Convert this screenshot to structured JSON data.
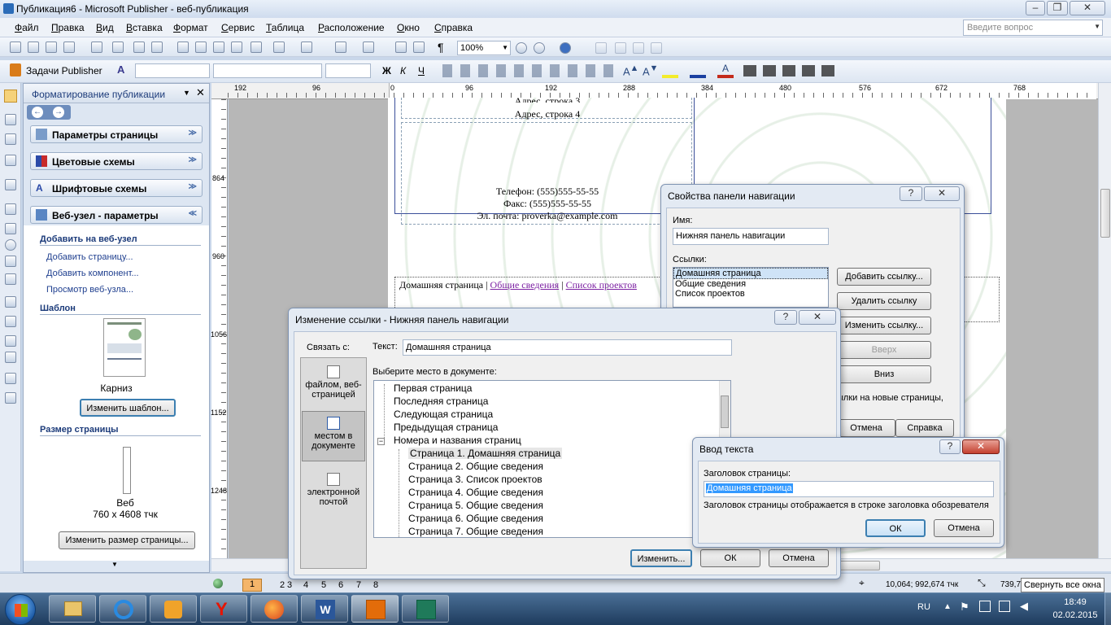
{
  "window": {
    "title": "Публикация6 - Microsoft Publisher - веб-публикация"
  },
  "menu": [
    "Файл",
    "Правка",
    "Вид",
    "Вставка",
    "Формат",
    "Сервис",
    "Таблица",
    "Расположение",
    "Окно",
    "Справка"
  ],
  "ask": {
    "placeholder": "Введите вопрос"
  },
  "toolbar": {
    "zoom": "100%",
    "tasks": "Задачи Publisher"
  },
  "ruler_h": [
    "192",
    "96",
    "0",
    "96",
    "192",
    "288",
    "384",
    "480",
    "576",
    "672",
    "768"
  ],
  "ruler_v": [
    "864",
    "960",
    "1056",
    "1152",
    "1248"
  ],
  "taskpane": {
    "title": "Форматирование публикации",
    "sections": [
      "Параметры страницы",
      "Цветовые схемы",
      "Шрифтовые схемы",
      "Веб-узел - параметры"
    ],
    "add_header": "Добавить на веб-узел",
    "links": [
      "Добавить страницу...",
      "Добавить компонент...",
      "Просмотр веб-узла..."
    ],
    "template_header": "Шаблон",
    "template_name": "Карниз",
    "change_template": "Изменить шаблон...",
    "size_header": "Размер страницы",
    "size_name": "Веб",
    "size_value": "760 x 4608 тчк",
    "change_size": "Изменить размер страницы..."
  },
  "page": {
    "address": "Адрес, строка 4",
    "address_prev": "Адрес, строка 3",
    "phone": "Телефон: (555)555-55-55",
    "fax": "Факс: (555)555-55-55",
    "email": "Эл. почта: proverka@example.com",
    "nav": [
      "Домашняя страница",
      "Общие сведения",
      "Список проектов"
    ]
  },
  "nav_dialog": {
    "title": "Свойства панели навигации",
    "name_label": "Имя:",
    "name_value": "Нижняя панель навигации",
    "links_label": "Ссылки:",
    "links": [
      "Домашняя страница",
      "Общие сведения",
      "Список проектов"
    ],
    "btn_add": "Добавить ссылку...",
    "btn_remove": "Удалить ссылку",
    "btn_change": "Изменить ссылку...",
    "btn_up": "Вверх",
    "btn_down": "Вниз",
    "checkbox_text": "ылки на новые страницы,",
    "btn_cancel": "Отмена",
    "btn_help": "Справка"
  },
  "link_dialog": {
    "title": "Изменение ссылки - Нижняя панель навигации",
    "link_to": "Связать с:",
    "opt_file": "файлом, веб-страницей",
    "opt_place": "местом в документе",
    "opt_email": "электронной почтой",
    "text_label": "Текст:",
    "text_value": "Домашняя страница",
    "choose_label": "Выберите место в документе:",
    "tree": [
      "Первая страница",
      "Последняя страница",
      "Следующая страница",
      "Предыдущая страница",
      "Номера и названия страниц",
      "Страница 1. Домашняя страница",
      "Страница 2. Общие сведения",
      "Страница 3. Список проектов",
      "Страница 4. Общие сведения",
      "Страница 5. Общие сведения",
      "Страница 6. Общие сведения",
      "Страница 7. Общие сведения"
    ],
    "btn_change": "Изменить...",
    "btn_ok": "ОК",
    "btn_cancel": "Отмена"
  },
  "input_dialog": {
    "title": "Ввод текста",
    "label": "Заголовок страницы:",
    "value": "Домашняя страница",
    "hint": "Заголовок страницы отображается в строке заголовка обозревателя",
    "btn_ok": "ОК",
    "btn_cancel": "Отмена"
  },
  "statusbar": {
    "pages": [
      "1",
      "2",
      "3",
      "4",
      "5",
      "6",
      "7",
      "8"
    ],
    "coords": "10,064; 992,674 тчк",
    "size": "739,7",
    "tooltip": "Свернуть все окна"
  },
  "taskbar": {
    "lang": "RU",
    "time": "18:49",
    "date": "02.02.2015"
  },
  "colors": {
    "accent": "#1f3f8f",
    "selection": "#3399ff"
  }
}
